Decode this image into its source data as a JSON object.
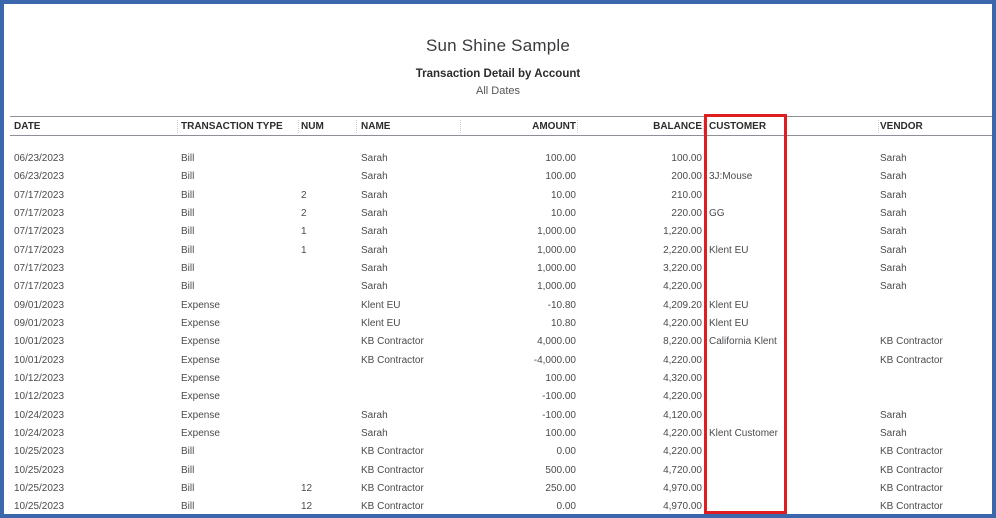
{
  "report": {
    "company": "Sun Shine Sample",
    "title": "Transaction Detail by Account",
    "date_range": "All Dates"
  },
  "columns": {
    "date": "DATE",
    "type": "TRANSACTION TYPE",
    "num": "NUM",
    "name": "NAME",
    "amount": "AMOUNT",
    "balance": "BALANCE",
    "customer": "CUSTOMER",
    "vendor": "VENDOR"
  },
  "highlight": {
    "column": "customer",
    "color": "#e01e22"
  },
  "frame_color": "#3b67ad",
  "rows": [
    {
      "date": "06/23/2023",
      "type": "Bill",
      "num": "",
      "name": "Sarah",
      "amount": "100.00",
      "balance": "100.00",
      "customer": "",
      "vendor": "Sarah"
    },
    {
      "date": "06/23/2023",
      "type": "Bill",
      "num": "",
      "name": "Sarah",
      "amount": "100.00",
      "balance": "200.00",
      "customer": "3J:Mouse",
      "vendor": "Sarah"
    },
    {
      "date": "07/17/2023",
      "type": "Bill",
      "num": "2",
      "name": "Sarah",
      "amount": "10.00",
      "balance": "210.00",
      "customer": "",
      "vendor": "Sarah"
    },
    {
      "date": "07/17/2023",
      "type": "Bill",
      "num": "2",
      "name": "Sarah",
      "amount": "10.00",
      "balance": "220.00",
      "customer": "GG",
      "vendor": "Sarah"
    },
    {
      "date": "07/17/2023",
      "type": "Bill",
      "num": "1",
      "name": "Sarah",
      "amount": "1,000.00",
      "balance": "1,220.00",
      "customer": "",
      "vendor": "Sarah"
    },
    {
      "date": "07/17/2023",
      "type": "Bill",
      "num": "1",
      "name": "Sarah",
      "amount": "1,000.00",
      "balance": "2,220.00",
      "customer": "Klent EU",
      "vendor": "Sarah"
    },
    {
      "date": "07/17/2023",
      "type": "Bill",
      "num": "",
      "name": "Sarah",
      "amount": "1,000.00",
      "balance": "3,220.00",
      "customer": "",
      "vendor": "Sarah"
    },
    {
      "date": "07/17/2023",
      "type": "Bill",
      "num": "",
      "name": "Sarah",
      "amount": "1,000.00",
      "balance": "4,220.00",
      "customer": "",
      "vendor": "Sarah"
    },
    {
      "date": "09/01/2023",
      "type": "Expense",
      "num": "",
      "name": "Klent EU",
      "amount": "-10.80",
      "balance": "4,209.20",
      "customer": "Klent EU",
      "vendor": ""
    },
    {
      "date": "09/01/2023",
      "type": "Expense",
      "num": "",
      "name": "Klent EU",
      "amount": "10.80",
      "balance": "4,220.00",
      "customer": "Klent EU",
      "vendor": ""
    },
    {
      "date": "10/01/2023",
      "type": "Expense",
      "num": "",
      "name": "KB Contractor",
      "amount": "4,000.00",
      "balance": "8,220.00",
      "customer": "California Klent",
      "vendor": "KB Contractor"
    },
    {
      "date": "10/01/2023",
      "type": "Expense",
      "num": "",
      "name": "KB Contractor",
      "amount": "-4,000.00",
      "balance": "4,220.00",
      "customer": "",
      "vendor": "KB Contractor"
    },
    {
      "date": "10/12/2023",
      "type": "Expense",
      "num": "",
      "name": "",
      "amount": "100.00",
      "balance": "4,320.00",
      "customer": "",
      "vendor": ""
    },
    {
      "date": "10/12/2023",
      "type": "Expense",
      "num": "",
      "name": "",
      "amount": "-100.00",
      "balance": "4,220.00",
      "customer": "",
      "vendor": ""
    },
    {
      "date": "10/24/2023",
      "type": "Expense",
      "num": "",
      "name": "Sarah",
      "amount": "-100.00",
      "balance": "4,120.00",
      "customer": "",
      "vendor": "Sarah"
    },
    {
      "date": "10/24/2023",
      "type": "Expense",
      "num": "",
      "name": "Sarah",
      "amount": "100.00",
      "balance": "4,220.00",
      "customer": "Klent Customer",
      "vendor": "Sarah"
    },
    {
      "date": "10/25/2023",
      "type": "Bill",
      "num": "",
      "name": "KB Contractor",
      "amount": "0.00",
      "balance": "4,220.00",
      "customer": "",
      "vendor": "KB Contractor"
    },
    {
      "date": "10/25/2023",
      "type": "Bill",
      "num": "",
      "name": "KB Contractor",
      "amount": "500.00",
      "balance": "4,720.00",
      "customer": "",
      "vendor": "KB Contractor"
    },
    {
      "date": "10/25/2023",
      "type": "Bill",
      "num": "12",
      "name": "KB Contractor",
      "amount": "250.00",
      "balance": "4,970.00",
      "customer": "",
      "vendor": "KB Contractor"
    },
    {
      "date": "10/25/2023",
      "type": "Bill",
      "num": "12",
      "name": "KB Contractor",
      "amount": "0.00",
      "balance": "4,970.00",
      "customer": "",
      "vendor": "KB Contractor"
    }
  ]
}
